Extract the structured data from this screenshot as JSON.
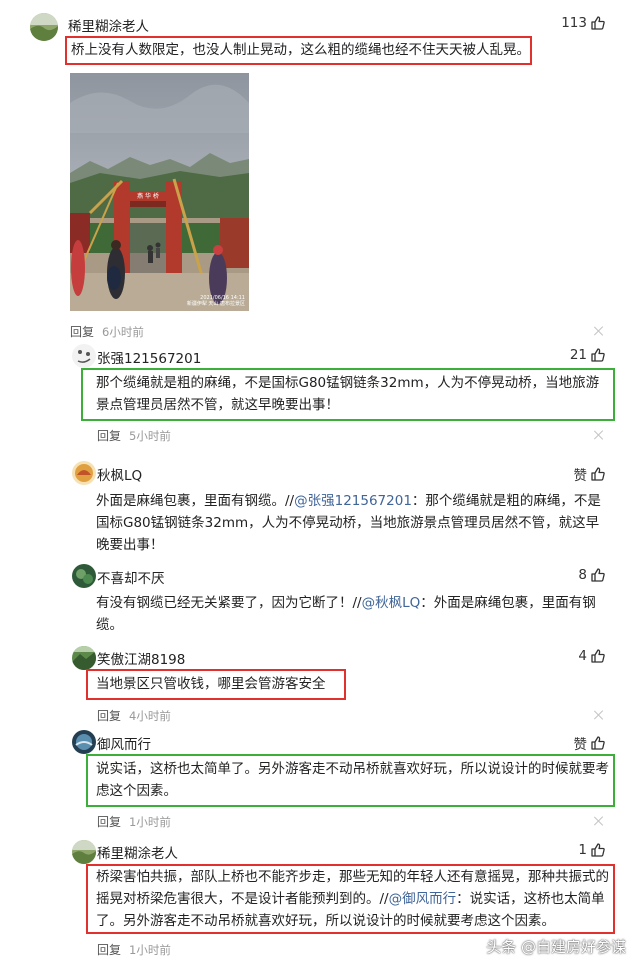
{
  "comments": [
    {
      "user": "稀里糊涂老人",
      "likes": "113",
      "text": "桥上没有人数限定，也没人制止晃动，这么粗的缆绳也经不住天天被人乱晃。",
      "reply_label": "回复",
      "time": "6小时前",
      "image": {
        "sign": "燕 华 桥",
        "stamp_line1": "2021/06/16 14:11",
        "stamp_line2": "新疆伊犁 天山 唐布拉景区"
      },
      "avatar_color": "#6d8a4e"
    },
    {
      "user": "张强121567201",
      "likes": "21",
      "text": "那个缆绳就是粗的麻绳，不是国标G80锰钢链条32mm，人为不停晃动桥，当地旅游景点管理员居然不管，就这早晚要出事！",
      "reply_label": "回复",
      "time": "5小时前",
      "avatar_color": "#dcdcdc"
    },
    {
      "user": "秋枫LQ",
      "likes": "赞",
      "text_plain": "外面是麻绳包裹，里面有钢缆。//",
      "mention": "@张强121567201",
      "text_after": "：那个缆绳就是粗的麻绳，不是国标G80锰钢链条32mm，人为不停晃动桥，当地旅游景点管理员居然不管，就这早晚要出事！",
      "avatar_color": "#d9823a"
    },
    {
      "user": "不喜却不厌",
      "likes": "8",
      "text_plain": "有没有钢缆已经无关紧要了，因为它断了！//",
      "mention": "@秋枫LQ",
      "text_after": "：外面是麻绳包裹，里面有钢缆。",
      "avatar_color": "#3e6d48"
    },
    {
      "user": "笑傲江湖8198",
      "likes": "4",
      "text": "当地景区只管收钱，哪里会管游客安全",
      "reply_label": "回复",
      "time": "4小时前",
      "avatar_color": "#4a7a3c"
    },
    {
      "user": "御风而行",
      "likes": "赞",
      "text": "说实话，这桥也太简单了。另外游客走不动吊桥就喜欢好玩，所以说设计的时候就要考虑这个因素。",
      "reply_label": "回复",
      "time": "1小时前",
      "avatar_color": "#2e5066"
    },
    {
      "user": "稀里糊涂老人",
      "likes": "1",
      "text_plain": "桥梁害怕共振，部队上桥也不能齐步走，那些无知的年轻人还有意摇晃，那种共振式的摇晃对桥梁危害很大，不是设计者能预判到的。//",
      "mention": "@御风而行",
      "text_after": "：说实话，这桥也太简单了。另外游客走不动吊桥就喜欢好玩，所以说设计的时候就要考虑这个因素。",
      "reply_label": "回复",
      "time": "1小时前",
      "avatar_color": "#6d8a4e"
    }
  ],
  "watermark": "头条 @自建房好参谋",
  "colors": {
    "red_box": "#e0312e",
    "green_box": "#3cae3a",
    "mention": "#406599"
  }
}
